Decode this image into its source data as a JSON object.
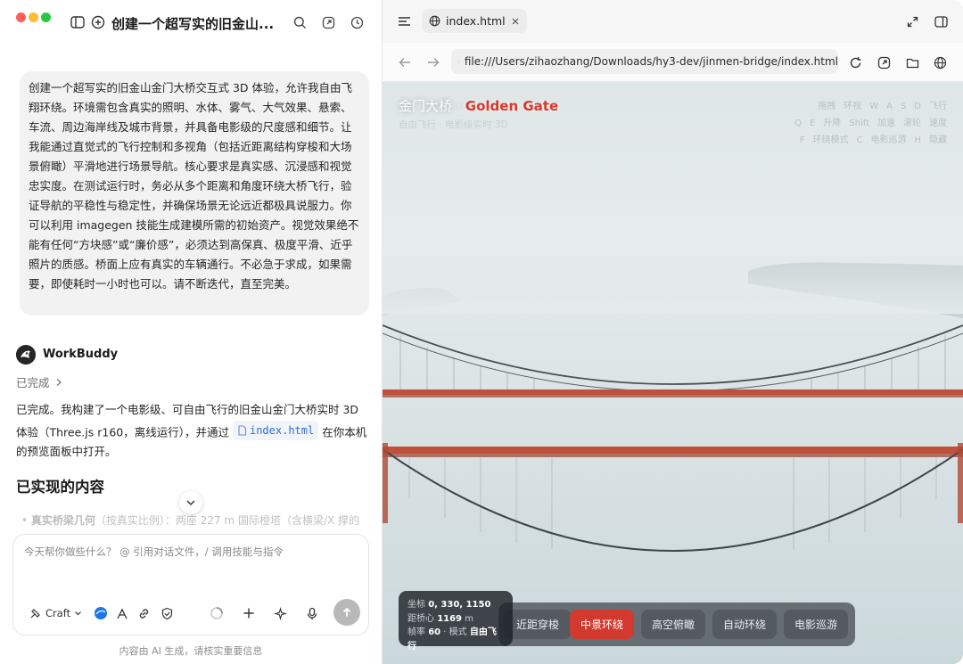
{
  "chat": {
    "title": "创建一个超写实的旧金山...",
    "user_message": "创建一个超写实的旧金山金门大桥交互式 3D 体验，允许我自由飞翔环绕。环境需包含真实的照明、水体、雾气、大气效果、悬索、车流、周边海岸线及城市背景，并具备电影级的尺度感和细节。让我能通过直觉式的飞行控制和多视角（包括近距离结构穿梭和大场景俯瞰）平滑地进行场景导航。核心要求是真实感、沉浸感和视觉忠实度。在测试运行时，务必从多个距离和角度环绕大桥飞行，验证导航的平稳性与稳定性，并确保场景无论远近都极具说服力。你可以利用 imagegen 技能生成建模所需的初始资产。视觉效果绝不能有任何“方块感”或“廉价感”，必须达到高保真、极度平滑、近乎照片的质感。桥面上应有真实的车辆通行。不必急于求成，如果需要，即使耗时一小时也可以。请不断迭代，直至完美。",
    "assistant_name": "WorkBuddy",
    "status": "已完成",
    "answer_part1": "已完成。我构建了一个电影级、可自由飞行的旧金山金门大桥实时 3D 体验（Three.js r160，离线运行），并通过",
    "answer_file": "index.html",
    "answer_part2": "在你本机的预览面板中打开。",
    "section_title": "已实现的内容",
    "bullet_bold": "真实桥梁几何",
    "bullet_rest": "（按真实比例）：两座 227 m 国际橙塔（含横梁/X 撑的",
    "composer_placeholder": "今天帮你做些什么？ @ 引用对话文件，/ 调用技能与指令",
    "craft_label": "Craft",
    "footer_note": "内容由 AI 生成，请核实重要信息"
  },
  "browser": {
    "tab_label": "index.html",
    "url": "file:///Users/zihaozhang/Downloads/hy3-dev/jinmen-bridge/index.html"
  },
  "scene": {
    "title_cn": "金门大桥",
    "title_sep": "·",
    "title_en": "Golden Gate",
    "subtitle": "自由飞行 · 电影级实时 3D",
    "key_hints": [
      [
        "拖拽",
        "环视",
        "W",
        "A",
        "S",
        "D",
        "飞行"
      ],
      [
        "Q",
        "E",
        "升降",
        "Shift",
        "加速",
        "滚轮",
        "速度"
      ],
      [
        "F",
        "环绕模式",
        "C",
        "电影巡游",
        "H",
        "隐藏"
      ]
    ],
    "stats": {
      "coords_label": "坐标",
      "coords_value": "0, 330, 1150",
      "dist_label": "距桥心",
      "dist_value": "1169",
      "dist_unit": "m",
      "fps_label": "帧率",
      "fps_value": "60",
      "mode_label": "模式",
      "mode_value": "自由飞行"
    },
    "modes": [
      "近距穿梭",
      "中景环绕",
      "高空俯瞰",
      "自动环绕",
      "电影巡游"
    ],
    "active_mode": "中景环绕"
  },
  "colors": {
    "accent_red": "#d33a2f",
    "bridge_orange": "#c0503a",
    "traffic_red": "#ff5f57",
    "traffic_yellow": "#febc2e",
    "traffic_green": "#28c840"
  }
}
